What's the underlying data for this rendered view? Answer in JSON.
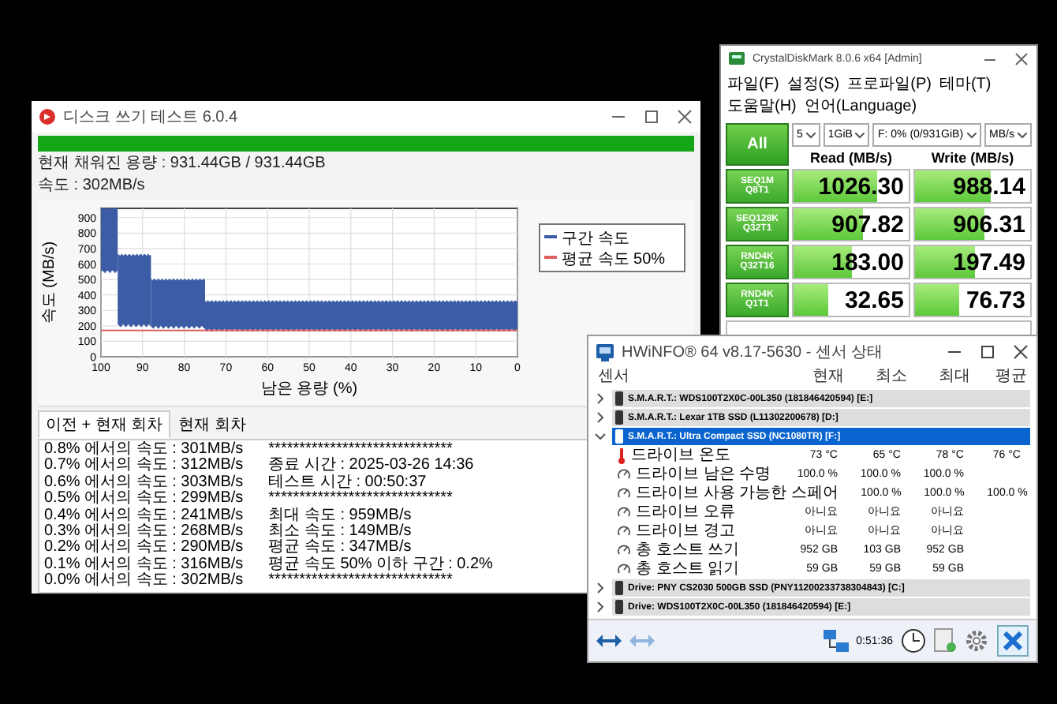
{
  "speed_test_window": {
    "title": "디스크 쓰기 테스트 6.0.4",
    "progress": {
      "level": 1
    },
    "filled_capacity": "현재 채워진 용량 : 931.44GB / 931.44GB",
    "speed": "속도 : 302MB/s",
    "chart": {
      "ylabel": "속도 (MB/s)",
      "xlabel": "남은 용량 (%)",
      "yticks": [
        "900",
        "800",
        "700",
        "600",
        "500",
        "400",
        "300",
        "200",
        "100",
        "0"
      ],
      "xticks": [
        "100",
        "90",
        "80",
        "70",
        "60",
        "50",
        "40",
        "30",
        "20",
        "10",
        "0"
      ],
      "legend": [
        {
          "label": "구간 속도",
          "color": "#3c5da6"
        },
        {
          "label": "평균 속도 50%",
          "color": "#e06060"
        }
      ]
    },
    "tabs": [
      {
        "label": "이전 + 현재 회차",
        "selected": true
      },
      {
        "label": "현재 회차",
        "selected": false
      }
    ],
    "log": [
      "0.8% 에서의 속도 : 301MB/s",
      "0.7% 에서의 속도 : 312MB/s",
      "0.6% 에서의 속도 : 303MB/s",
      "0.5% 에서의 속도 : 299MB/s",
      "0.4% 에서의 속도 : 241MB/s",
      "0.3% 에서의 속도 : 268MB/s",
      "0.2% 에서의 속도 : 290MB/s",
      "0.1% 에서의 속도 : 316MB/s",
      "0.0% 에서의 속도 : 302MB/s",
      "******************************",
      "종료 시간 : 2025-03-26 14:36",
      "테스트 시간 : 00:50:37",
      "******************************",
      "최대 속도 : 959MB/s",
      "최소 속도 : 149MB/s",
      "평균 속도 : 347MB/s",
      "평균 속도 50% 이하 구간 : 0.2%",
      "******************************"
    ]
  },
  "crystaldiskmark": {
    "title": "CrystalDiskMark 8.0.6 x64 [Admin]",
    "menu": [
      "파일(F)",
      "설정(S)",
      "프로파일(P)",
      "테마(T)",
      "도움말(H)",
      "언어(Language)"
    ],
    "all_button": "All",
    "selects": [
      "5",
      "1GiB",
      "F: 0% (0/931GiB)",
      "MB/s"
    ],
    "headers": [
      "Read (MB/s)",
      "Write (MB/s)"
    ],
    "rows": [
      {
        "test": "SEQ1M",
        "queue": "Q8T1",
        "read": {
          "value": "1026.30",
          "level": 0.72
        },
        "write": {
          "value": "988.14",
          "level": 0.66
        }
      },
      {
        "test": "SEQ128K",
        "queue": "Q32T1",
        "read": {
          "value": "907.82",
          "level": 0.6
        },
        "write": {
          "value": "906.31",
          "level": 0.6
        }
      },
      {
        "test": "RND4K",
        "queue": "Q32T16",
        "read": {
          "value": "183.00",
          "level": 0.5
        },
        "write": {
          "value": "197.49",
          "level": 0.52
        }
      },
      {
        "test": "RND4K",
        "queue": "Q1T1",
        "read": {
          "value": "32.65",
          "level": 0.3
        },
        "write": {
          "value": "76.73",
          "level": 0.38
        }
      }
    ]
  },
  "hwinfo": {
    "title": "HWiNFO® 64 v8.17-5630 - 센서 상태",
    "columns": [
      "센서",
      "현재",
      "최소",
      "최대",
      "평균"
    ],
    "groups": [
      {
        "label": "S.M.A.R.T.: WDS100T2X0C-00L350 (181846420594) [E:]",
        "expanded": false,
        "selected": false
      },
      {
        "label": "S.M.A.R.T.: Lexar 1TB SSD (L11302200678) [D:]",
        "expanded": false,
        "selected": false
      },
      {
        "label": "S.M.A.R.T.: Ultra Compact SSD (NC1080TR) [F:]",
        "expanded": true,
        "selected": true,
        "rows": [
          {
            "kind": "temperature",
            "name": "드라이브 온도",
            "values": [
              "73 °C",
              "65 °C",
              "78 °C",
              "76 °C"
            ]
          },
          {
            "kind": "gauge",
            "name": "드라이브 남은 수명",
            "values": [
              "100.0 %",
              "100.0 %",
              "100.0 %"
            ]
          },
          {
            "kind": "gauge",
            "name": "드라이브 사용 가능한 스페어",
            "values": [
              "100.0 %",
              "100.0 %",
              "100.0 %"
            ]
          },
          {
            "kind": "gauge",
            "name": "드라이브 오류",
            "values": [
              "아니요",
              "아니요",
              "아니요"
            ]
          },
          {
            "kind": "gauge",
            "name": "드라이브 경고",
            "values": [
              "아니요",
              "아니요",
              "아니요"
            ]
          },
          {
            "kind": "gauge",
            "name": "총 호스트 쓰기",
            "values": [
              "952 GB",
              "103 GB",
              "952 GB"
            ]
          },
          {
            "kind": "gauge",
            "name": "총 호스트 읽기",
            "values": [
              "59 GB",
              "59 GB",
              "59 GB"
            ]
          }
        ]
      },
      {
        "label": "Drive: PNY CS2030 500GB SSD (PNY11200233738304843) [C:]",
        "expanded": false,
        "selected": false
      },
      {
        "label": "Drive: WDS100T2X0C-00L350 (181846420594) [E:]",
        "expanded": false,
        "selected": false
      }
    ],
    "timer": "0:51:36"
  }
}
